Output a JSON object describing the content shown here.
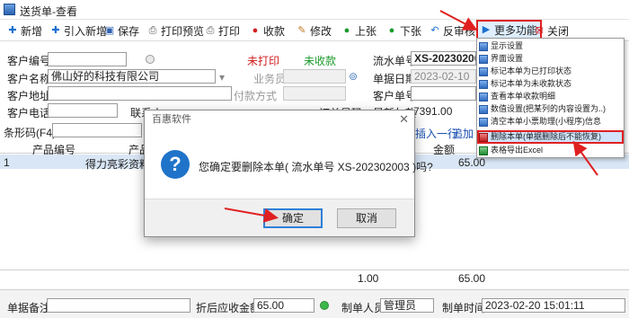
{
  "window": {
    "title": "送货单-查看"
  },
  "toolbar": {
    "new": "新增",
    "import_new": "引入新增",
    "save": "保存",
    "print_preview": "打印预览",
    "print": "打印",
    "collect": "收款",
    "modify": "修改",
    "prev": "上张",
    "next": "下张",
    "unapprove": "反审核",
    "more": "更多功能",
    "close": "关闭"
  },
  "form": {
    "customer_code_label": "客户编号",
    "customer_name_label": "客户名称",
    "customer_name_value": "佛山好的科技有限公司",
    "customer_address_label": "客户地址",
    "customer_phone_label": "客户电话",
    "contact_label": "联系人",
    "print_status": "未打印",
    "collect_status": "未收款",
    "salesperson_label": "业务员",
    "payment_method_label": "付款方式",
    "order_no_label": "订单号码",
    "serial_label": "流水单号",
    "serial_value": "XS-20230200",
    "date_label": "单据日期",
    "date_value": "2023-02-10",
    "customer_order_label": "客户单号",
    "latest_debt_label": "最新欠款",
    "latest_debt_value": "7391.00",
    "barcode_label": "条形码(F4)",
    "insert_row": "插入一行",
    "add_row": "追加"
  },
  "grid": {
    "headers": [
      "产品编号",
      "产品名",
      "金额"
    ],
    "rows": [
      {
        "index": "1",
        "product_name": "得力亮彩资料册",
        "amount": "65.00"
      }
    ],
    "totals": {
      "qty": "1.00",
      "amount": "65.00"
    }
  },
  "bottom": {
    "remark_label": "单据备注",
    "discount_label": "折后应收金额",
    "discount_value": "65.00",
    "creator_label": "制单人员",
    "creator_value": "管理员",
    "create_time_label": "制单时间",
    "create_time_value": "2023-02-20 15:01:11"
  },
  "menu": {
    "items": [
      "显示设置",
      "界面设置",
      "标记本单为已打印状态",
      "标记本单为未收款状态",
      "查看本单收款明细",
      "数值设置(把某列的内容设置为..)",
      "清空本单小票助理(小程序)信息",
      "删除本单(单据删除后不能恢复)",
      "表格导出Excel"
    ]
  },
  "dialog": {
    "title": "百惠软件",
    "message": "您确定要删除本单( 流水单号 XS-202302003 )吗?",
    "ok": "确定",
    "cancel": "取消"
  },
  "colors": {
    "accent": "#e02020",
    "highlight": "#cfe3fb",
    "info": "#1f73c9",
    "red_status": "#d22020",
    "green_status": "#1a9a2a"
  }
}
